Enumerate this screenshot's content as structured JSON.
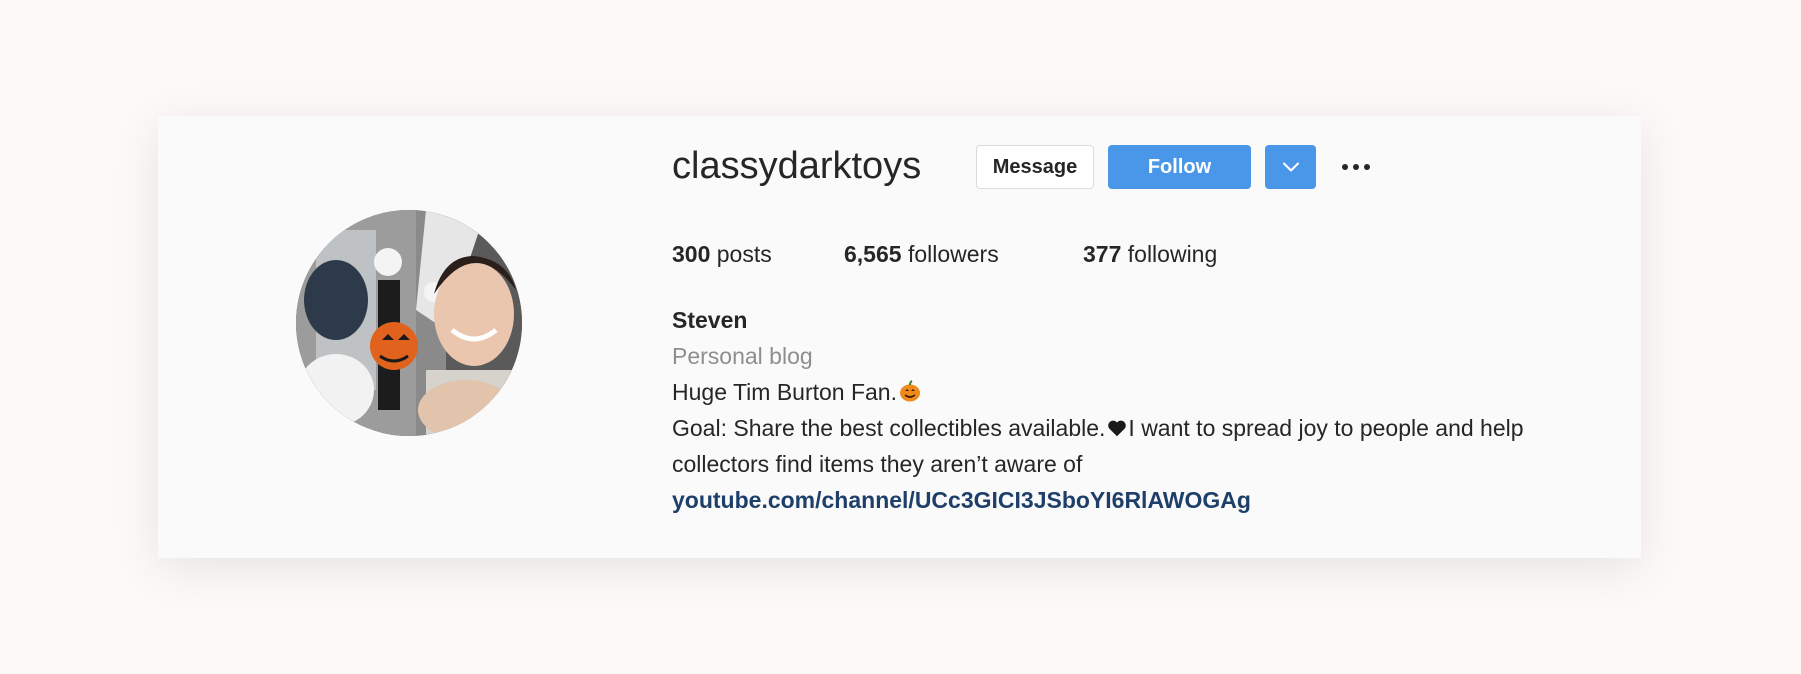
{
  "profile": {
    "username": "classydarktoys",
    "avatar_alt": "profile photo",
    "buttons": {
      "message": "Message",
      "follow": "Follow"
    },
    "stats": {
      "posts_count": "300",
      "posts_label": "posts",
      "followers_count": "6,565",
      "followers_label": "followers",
      "following_count": "377",
      "following_label": "following"
    },
    "bio": {
      "name": "Steven",
      "category": "Personal blog",
      "line1": "Huge Tim Burton Fan.",
      "line2a": "Goal: Share the best collectibles available.",
      "line2b": "I want to spread joy to people and help",
      "line3": "collectors find items they aren’t aware of",
      "link": "youtube.com/channel/UCc3GICI3JSboYI6RlAWOGAg"
    }
  },
  "icons": {
    "dropdown": "chevron-down-icon",
    "more": "more-horizontal-icon",
    "pumpkin": "jack-o-lantern-emoji",
    "heart": "black-heart-emoji"
  },
  "colors": {
    "accent": "#4a97ea",
    "link": "#1f3f6b",
    "muted": "#8e8e8e",
    "text": "#262626"
  }
}
